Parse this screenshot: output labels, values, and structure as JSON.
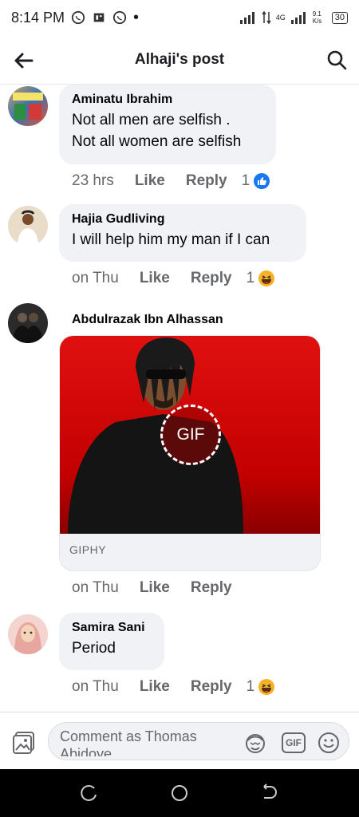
{
  "status": {
    "time": "8:14 PM",
    "network": "4G",
    "speed": "9.1 K/s",
    "battery": "30"
  },
  "header": {
    "title": "Alhaji's post"
  },
  "comments": [
    {
      "author": "Aminatu Ibrahim",
      "lines": [
        "Not all men are selfish .",
        "Not all women are selfish"
      ],
      "time": "23 hrs",
      "like": "Like",
      "reply": "Reply",
      "reactions": "1",
      "reaction_icon": "like-icon"
    },
    {
      "author": "Hajia Gudliving",
      "lines": [
        "I will help him my man if I can"
      ],
      "time": "on Thu",
      "like": "Like",
      "reply": "Reply",
      "reactions": "1",
      "reaction_icon": "haha-icon"
    },
    {
      "author": "Abdulrazak Ibn Alhassan",
      "gif_badge": "GIF",
      "gif_source": "GIPHY",
      "time": "on Thu",
      "like": "Like",
      "reply": "Reply"
    },
    {
      "author": "Samira Sani",
      "lines": [
        "Period"
      ],
      "time": "on Thu",
      "like": "Like",
      "reply": "Reply",
      "reactions": "1",
      "reaction_icon": "haha-icon"
    }
  ],
  "composer": {
    "placeholder": "Comment as Thomas Abidoye",
    "gif_label": "GIF"
  },
  "colors": {
    "facebook_blue": "#1877f2",
    "bubble_bg": "#f0f2f5",
    "meta_text": "#65676b"
  }
}
